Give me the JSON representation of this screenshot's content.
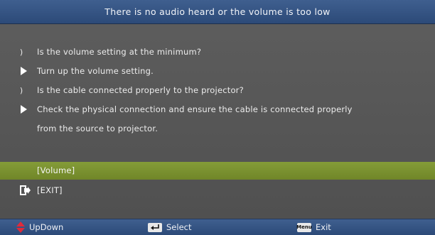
{
  "dialog": {
    "title": "There is no audio heard or the volume is too low"
  },
  "lines": [
    {
      "bullet": "question",
      "symbol": ")",
      "text": "Is the volume setting at the minimum?"
    },
    {
      "bullet": "arrow",
      "symbol": "",
      "text": "Turn up the volume setting."
    },
    {
      "bullet": "question",
      "symbol": ")",
      "text": "Is the cable connected properly to the projector?"
    },
    {
      "bullet": "arrow",
      "symbol": "",
      "text": "Check the physical connection and ensure the cable is connected properly"
    },
    {
      "bullet": "none",
      "symbol": "",
      "text": "from the source to projector."
    }
  ],
  "menu": {
    "volume_label": "[Volume]",
    "exit_label": "[EXIT]",
    "selected": "volume"
  },
  "statusbar": {
    "updown_label": "UpDown",
    "select_label": "Select",
    "menu_key_label": "Menu",
    "exit_label": "Exit"
  },
  "colors": {
    "title_bg": "#34528a",
    "panel_bg": "#585858",
    "selected_row": "#7a9230",
    "updown_icon": "#e02a3a"
  },
  "icons": {
    "exit": "exit-door-icon",
    "updown": "up-down-arrows-icon",
    "select": "enter-key-icon",
    "menu": "menu-key-icon"
  }
}
